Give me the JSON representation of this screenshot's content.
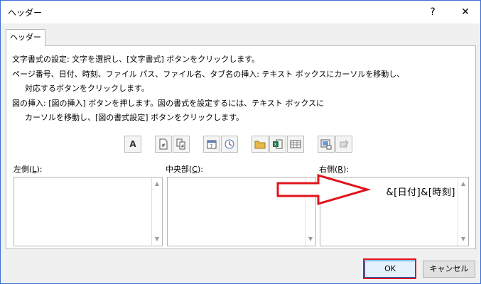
{
  "window": {
    "title": "ヘッダー",
    "help": "?",
    "close": "✕"
  },
  "tab": {
    "label": "ヘッダー"
  },
  "instructions": {
    "line1": "文字書式の設定: 文字を選択し、[文字書式] ボタンをクリックします。",
    "line2": "ページ番号、日付、時刻、ファイル パス、ファイル名、タブ名の挿入: テキスト ボックスにカーソルを移動し、",
    "line3": "対応するボタンをクリックします。",
    "line4": "図の挿入: [図の挿入] ボタンを押します。図の書式を設定するには、テキスト ボックスに",
    "line5": "カーソルを移動し、[図の書式設定] ボタンをクリックします。"
  },
  "toolbar": {
    "icons": [
      "format-text-icon",
      "page-number-icon",
      "pages-count-icon",
      "date-icon",
      "time-icon",
      "file-path-icon",
      "file-name-icon",
      "sheet-name-icon",
      "insert-picture-icon",
      "format-picture-icon"
    ],
    "format_text_glyph": "A"
  },
  "sections": {
    "left": {
      "label_prefix": "左側(",
      "label_key": "L",
      "label_suffix": "):",
      "value": ""
    },
    "center": {
      "label_prefix": "中央部(",
      "label_key": "C",
      "label_suffix": "):",
      "value": ""
    },
    "right": {
      "label_prefix": "右側(",
      "label_key": "R",
      "label_suffix": "):",
      "value": "&[日付]&[時刻]"
    }
  },
  "buttons": {
    "ok": "OK",
    "cancel": "キャンセル"
  },
  "colors": {
    "accent": "#0078d7",
    "highlight": "#e0141e",
    "window_border": "#3b6fd6"
  }
}
